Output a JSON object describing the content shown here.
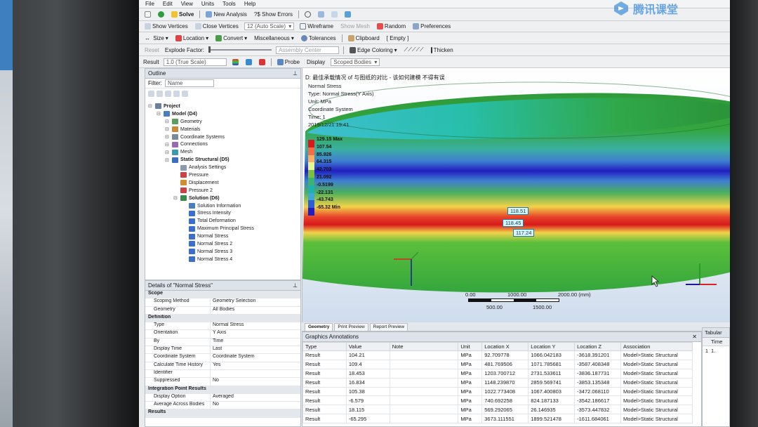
{
  "menu": [
    "File",
    "Edit",
    "View",
    "Units",
    "Tools",
    "Help"
  ],
  "toolbar1": {
    "solve": "Solve",
    "new_analysis": "New Analysis",
    "show_errors": "?$ Show Errors"
  },
  "toolbar2": {
    "show_vertices": "Show Vertices",
    "close_vertices": "Close Vertices",
    "auto_scale": "12 (Auto Scale)",
    "wireframe": "Wireframe",
    "show_mesh": "Show Mesh",
    "random": "Random",
    "preferences": "Preferences"
  },
  "toolbar3": {
    "size": "Size",
    "location": "Location",
    "convert": "Convert",
    "miscellaneous": "Miscellaneous",
    "tolerances": "Tolerances",
    "clipboard": "Clipboard",
    "empty": "[ Empty ]"
  },
  "toolbar4": {
    "reset": "Reset",
    "explode_factor": "Explode Factor:",
    "assembly_center": "Assembly Center",
    "edge_coloring": "Edge Coloring",
    "thicken": "Thicken"
  },
  "toolbar5": {
    "result": "Result",
    "scale": "1.0 (True Scale)",
    "probe": "Probe",
    "display": "Display",
    "scoped_bodies": "Scoped Bodies"
  },
  "watermark": "腾讯课堂",
  "outline": {
    "title": "Outline",
    "filter_label": "Filter:",
    "filter_value": "Name",
    "tree": [
      {
        "label": "Project",
        "depth": 0,
        "bold": true,
        "icon": "project-icon"
      },
      {
        "label": "Model (D4)",
        "depth": 1,
        "bold": true,
        "icon": "model-icon"
      },
      {
        "label": "Geometry",
        "depth": 2,
        "bold": false,
        "icon": "geometry-icon"
      },
      {
        "label": "Materials",
        "depth": 2,
        "bold": false,
        "icon": "materials-icon"
      },
      {
        "label": "Coordinate Systems",
        "depth": 2,
        "bold": false,
        "icon": "coordinate-systems-icon"
      },
      {
        "label": "Connections",
        "depth": 2,
        "bold": false,
        "icon": "connections-icon"
      },
      {
        "label": "Mesh",
        "depth": 2,
        "bold": false,
        "icon": "mesh-icon"
      },
      {
        "label": "Static Structural (D5)",
        "depth": 2,
        "bold": true,
        "icon": "static-structural-icon"
      },
      {
        "label": "Analysis Settings",
        "depth": 3,
        "bold": false,
        "icon": "analysis-settings-icon"
      },
      {
        "label": "Pressure",
        "depth": 3,
        "bold": false,
        "icon": "pressure-icon"
      },
      {
        "label": "Displacement",
        "depth": 3,
        "bold": false,
        "icon": "displacement-icon"
      },
      {
        "label": "Pressure 2",
        "depth": 3,
        "bold": false,
        "icon": "pressure-icon"
      },
      {
        "label": "Solution (D6)",
        "depth": 3,
        "bold": true,
        "icon": "solution-icon"
      },
      {
        "label": "Solution Information",
        "depth": 4,
        "bold": false,
        "icon": "solution-information-icon"
      },
      {
        "label": "Stress Intensity",
        "depth": 4,
        "bold": false,
        "icon": "result-icon"
      },
      {
        "label": "Total Deformation",
        "depth": 4,
        "bold": false,
        "icon": "result-icon"
      },
      {
        "label": "Maximum Principal Stress",
        "depth": 4,
        "bold": false,
        "icon": "result-icon"
      },
      {
        "label": "Normal Stress",
        "depth": 4,
        "bold": false,
        "icon": "result-icon"
      },
      {
        "label": "Normal Stress 2",
        "depth": 4,
        "bold": false,
        "icon": "result-icon"
      },
      {
        "label": "Normal Stress 3",
        "depth": 4,
        "bold": false,
        "icon": "result-icon"
      },
      {
        "label": "Normal Stress 4",
        "depth": 4,
        "bold": false,
        "icon": "result-icon"
      }
    ]
  },
  "details": {
    "title": "Details of \"Normal Stress\"",
    "rows": [
      {
        "section": true,
        "key": "Scope"
      },
      {
        "key": "Scoping Method",
        "value": "Geometry Selection"
      },
      {
        "key": "Geometry",
        "value": "All Bodies"
      },
      {
        "section": true,
        "key": "Definition"
      },
      {
        "key": "Type",
        "value": "Normal Stress"
      },
      {
        "key": "Orientation",
        "value": "Y Axis"
      },
      {
        "key": "By",
        "value": "Time"
      },
      {
        "key": "Display Time",
        "value": "Last"
      },
      {
        "key": "Coordinate System",
        "value": "Coordinate System"
      },
      {
        "key": "Calculate Time History",
        "value": "Yes"
      },
      {
        "key": "Identifier",
        "value": ""
      },
      {
        "key": "Suppressed",
        "value": "No"
      },
      {
        "section": true,
        "key": "Integration Point Results"
      },
      {
        "key": "Display Option",
        "value": "Averaged"
      },
      {
        "key": "Average Across Bodies",
        "value": "No"
      },
      {
        "section": true,
        "key": "Results"
      }
    ]
  },
  "viewport": {
    "title": "D: 最佳承载情况 of 与图纸的对比 - 该如何建模 不得有误",
    "meta": [
      "Normal Stress",
      "Type: Normal Stress(Y Axis)",
      "Unit: MPa",
      "Coordinate System",
      "Time: 1",
      "2019/12/21 19:41"
    ],
    "legend_max": "129.15 Max",
    "legend_min": "-65.32 Min",
    "legend_values": [
      "107.54",
      "85.926",
      "64.315",
      "42.703",
      "21.092",
      "-0.5199",
      "-22.131",
      "-43.743"
    ],
    "legend_colors": [
      "#d7191c",
      "#f46d43",
      "#fdae61",
      "#e6f598",
      "#7fbf3f",
      "#3cb371",
      "#20b2aa",
      "#3fa7d6",
      "#2c5fd4",
      "#1f1fbf"
    ],
    "probes": [
      "118.51",
      "118.45",
      "117.24"
    ],
    "scale_labels": [
      "0.00",
      "1000.00",
      "2000.00 (mm)",
      "500.00",
      "1500.00"
    ]
  },
  "view_tabs": [
    "Geometry",
    "Print Preview",
    "Report Preview"
  ],
  "annotations": {
    "title": "Graphics Annotations",
    "columns": [
      "Type",
      "Value",
      "Note",
      "Unit",
      "Location X",
      "Location Y",
      "Location Z",
      "Association"
    ],
    "rows": [
      [
        "Result",
        "104.21",
        "",
        "MPa",
        "92.709778",
        "1066.042183",
        "-3618.391201",
        "Model>Static Structural"
      ],
      [
        "Result",
        "109.4",
        "",
        "MPa",
        "481.769506",
        "1071.785681",
        "-3587.408348",
        "Model>Static Structural"
      ],
      [
        "Result",
        "18.453",
        "",
        "MPa",
        "1203.700712",
        "2731.533611",
        "-3836.187731",
        "Model>Static Structural"
      ],
      [
        "Result",
        "16.834",
        "",
        "MPa",
        "1148.239870",
        "2859.569741",
        "-3853.135348",
        "Model>Static Structural"
      ],
      [
        "Result",
        "105.38",
        "",
        "MPa",
        "1022.773408",
        "1067.400803",
        "-3472.068110",
        "Model>Static Structural"
      ],
      [
        "Result",
        "-6.579",
        "",
        "MPa",
        "740.692258",
        "824.187133",
        "-3542.186617",
        "Model>Static Structural"
      ],
      [
        "Result",
        "18.115",
        "",
        "MPa",
        "569.292065",
        "26.146935",
        "-3573.447832",
        "Model>Static Structural"
      ],
      [
        "Result",
        "-65.295",
        "",
        "MPa",
        "3673.111551",
        "1899.521478",
        "-1611.684061",
        "Model>Static Structural"
      ]
    ]
  },
  "tabular": {
    "title": "Tabular",
    "col": "Time",
    "row_index": "1",
    "row_val": "1."
  },
  "colors": {
    "accent": "#2f6fb5",
    "panel_title": "#dde3ea",
    "screen": "#e9ecef"
  }
}
